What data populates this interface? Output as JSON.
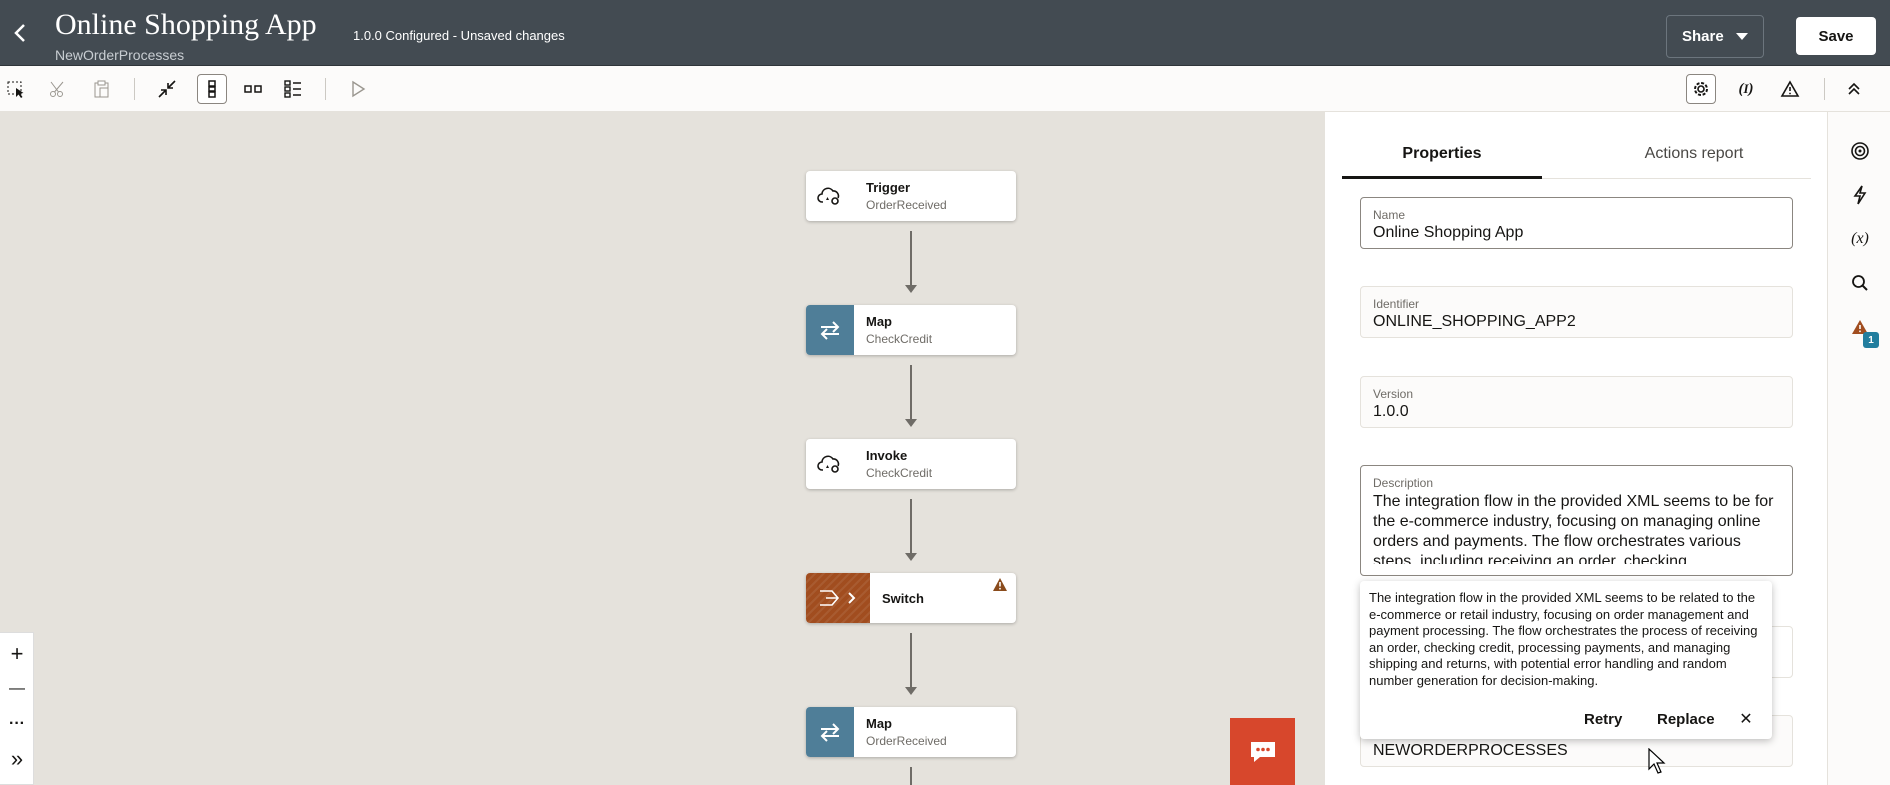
{
  "header": {
    "title": "Online Shopping App",
    "subtitle": "NewOrderProcesses",
    "status": "1.0.0 Configured - Unsaved changes",
    "share_label": "Share",
    "save_label": "Save"
  },
  "toolbar": {
    "icons": [
      "select-icon",
      "cut-icon",
      "paste-icon",
      "collapse-icon",
      "vertical-layout-icon",
      "horizontal-layout-icon",
      "pseudo-layout-icon",
      "run-icon",
      "settings-icon",
      "expression-icon",
      "warning-icon",
      "collapse-header-icon"
    ]
  },
  "flow": {
    "nodes": [
      {
        "title": "Trigger",
        "sub": "OrderReceived",
        "icon": "cloud-icon"
      },
      {
        "title": "Map",
        "sub": "CheckCredit",
        "icon": "map-arrows-icon"
      },
      {
        "title": "Invoke",
        "sub": "CheckCredit",
        "icon": "cloud-icon"
      },
      {
        "title": "Switch",
        "sub": "",
        "icon": "switch-icon"
      },
      {
        "title": "Map",
        "sub": "OrderReceived",
        "icon": "map-arrows-icon"
      }
    ]
  },
  "zoom": {
    "plus": "+",
    "minus": "—",
    "more": "···",
    "expand": "»"
  },
  "panel": {
    "tabs": [
      {
        "label": "Properties",
        "active": true
      },
      {
        "label": "Actions report",
        "active": false
      }
    ],
    "fields": {
      "name_label": "Name",
      "name_value": "Online Shopping App",
      "identifier_label": "Identifier",
      "identifier_value": "ONLINE_SHOPPING_APP2",
      "version_label": "Version",
      "version_value": "1.0.0",
      "description_label": "Description",
      "description_value": "The integration flow in the provided XML seems to be for the e-commerce industry, focusing on managing online orders and payments. The flow orchestrates various steps, including receiving an order, checking",
      "package_value": "NEWORDERPROCESSES"
    },
    "suggestion": {
      "text": "The integration flow in the provided XML seems to be related to the e-commerce or retail industry, focusing on order management and payment processing. The flow orchestrates the process of receiving an order, checking credit, processing payments, and managing shipping and returns, with potential error handling and random number generation for decision-making.",
      "retry_label": "Retry",
      "replace_label": "Replace",
      "close_label": "✕"
    }
  },
  "rail": {
    "expression_label": "(x)",
    "warning_count": "1"
  },
  "colors": {
    "header_bg": "#434b52",
    "canvas_bg": "#e5e2dc",
    "map_accent": "#4f7e98",
    "switch_accent": "#a14d1f",
    "chat_fab": "#d7472c",
    "badge": "#227e9e"
  }
}
